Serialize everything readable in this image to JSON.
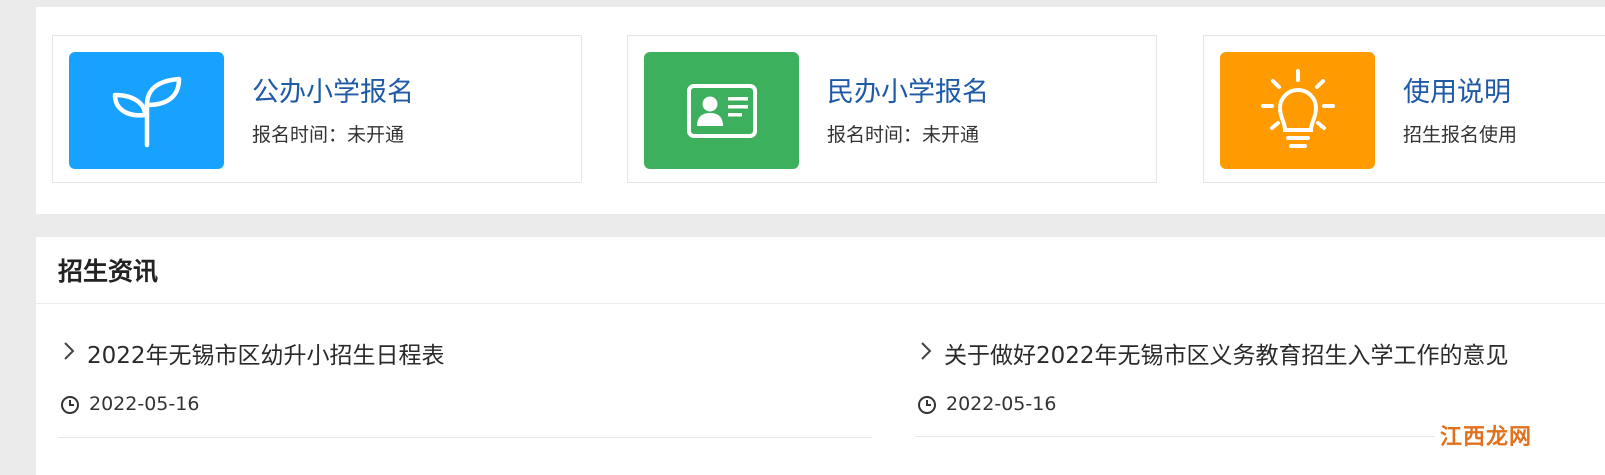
{
  "cards": [
    {
      "title": "公办小学报名",
      "subtitle": "报名时间：未开通",
      "color": "#17a2ff",
      "icon": "sprout-icon"
    },
    {
      "title": "民办小学报名",
      "subtitle": "报名时间：未开通",
      "color": "#3db05e",
      "icon": "id-card-icon"
    },
    {
      "title": "使用说明",
      "subtitle": "招生报名使用",
      "color": "#ff9a00",
      "icon": "lightbulb-icon"
    }
  ],
  "news": {
    "heading": "招生资讯",
    "items": [
      {
        "title": "2022年无锡市区幼升小招生日程表",
        "date": "2022-05-16"
      },
      {
        "title": "关于做好2022年无锡市区义务教育招生入学工作的意见",
        "date": "2022-05-16"
      }
    ]
  },
  "watermark": "江西龙网"
}
